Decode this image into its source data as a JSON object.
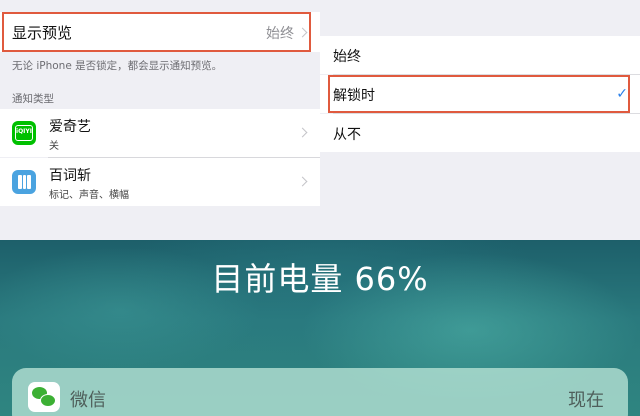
{
  "settings": {
    "preview_label": "显示预览",
    "preview_value": "始终",
    "description": "无论 iPhone 是否锁定，都会显示通知预览。",
    "section_title": "通知类型",
    "apps": [
      {
        "name": "爱奇艺",
        "subtitle": "关",
        "icon": "iqiyi-icon",
        "icon_text": "iQIYI"
      },
      {
        "name": "百词斩",
        "subtitle": "标记、声音、横幅",
        "icon": "baicizhan-icon"
      }
    ]
  },
  "preview_options": {
    "options": [
      "始终",
      "解锁时",
      "从不"
    ],
    "selected": "解锁时"
  },
  "lock_screen": {
    "battery_text": "目前电量 66%",
    "notification": {
      "app": "微信",
      "time": "现在",
      "icon": "wechat-icon"
    }
  },
  "colors": {
    "highlight_border": "#e05a3e",
    "checkmark": "#2a80ea",
    "iqiyi_green": "#00c000",
    "baicizhan_blue": "#4aa3e0"
  }
}
